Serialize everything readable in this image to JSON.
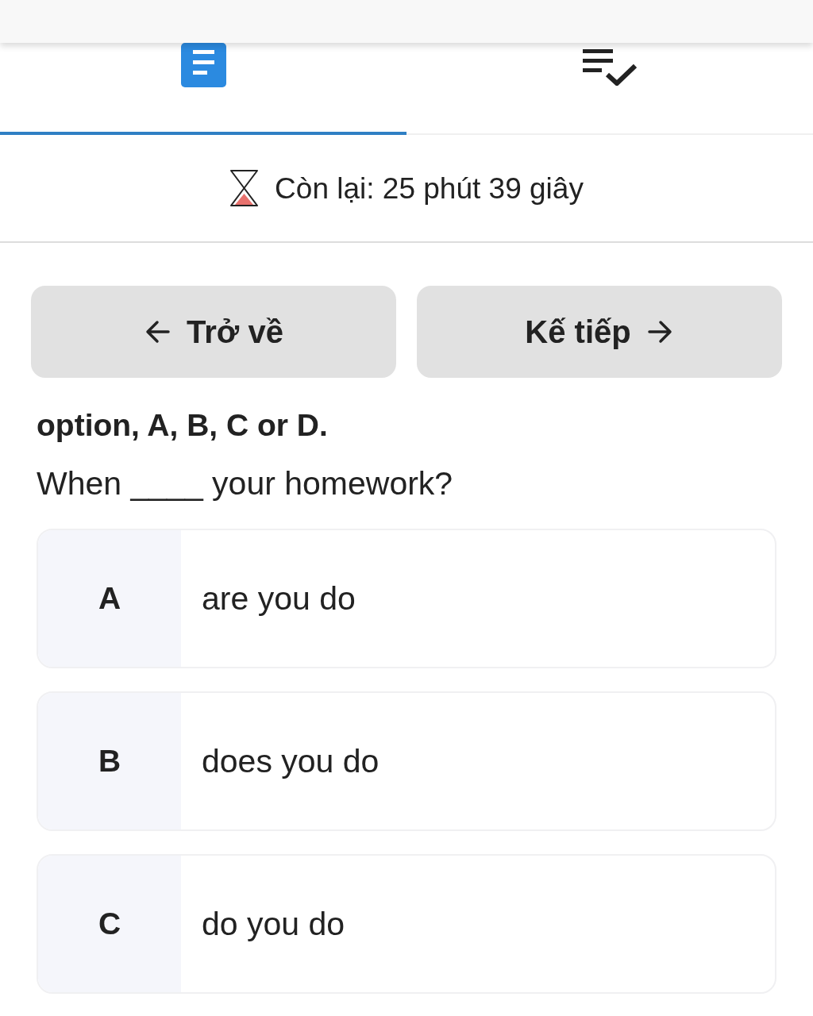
{
  "tabs": [
    {
      "kind": "document",
      "selected": true
    },
    {
      "kind": "checklist",
      "selected": false
    }
  ],
  "timer": {
    "label": "Còn lại: 25 phút 39 giây"
  },
  "nav_buttons": [
    {
      "kind": "back",
      "label": "Trở về"
    },
    {
      "kind": "next",
      "label": "Kế tiếp"
    }
  ],
  "instruction": "option, A, B, C or D.",
  "question": "When ____ your homework?",
  "options": [
    {
      "letter": "A",
      "text": "are you do",
      "selected": false
    },
    {
      "letter": "B",
      "text": "does you do",
      "selected": false
    },
    {
      "letter": "C",
      "text": "do you do",
      "selected": false
    }
  ]
}
